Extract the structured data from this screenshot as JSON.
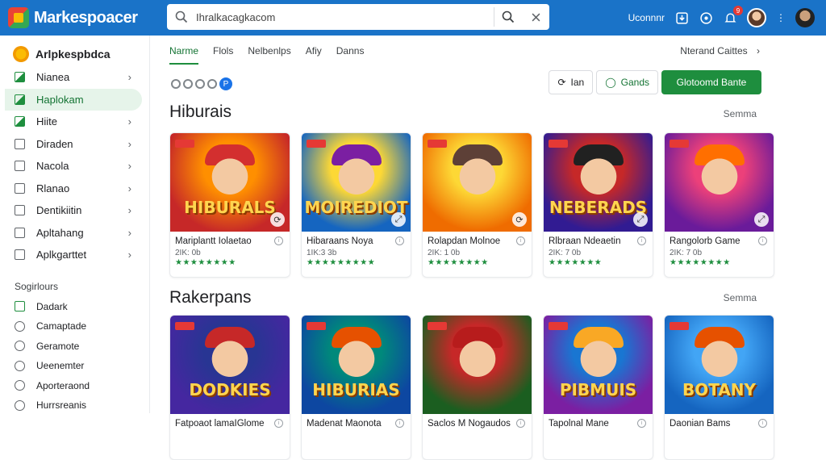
{
  "app": {
    "name": "Markespoacer",
    "search_value": "Ihralkacagkacom",
    "account_label": "Uconnnr",
    "notification_count": "9"
  },
  "sidebar": {
    "brand": "Arlpkespbdca",
    "items": [
      {
        "label": "Nianea",
        "chevron": "›"
      },
      {
        "label": "Haplokam",
        "chevron": ""
      },
      {
        "label": "Hiite",
        "chevron": "›"
      },
      {
        "label": "Diraden",
        "chevron": "›"
      },
      {
        "label": "Nacola",
        "chevron": "›"
      },
      {
        "label": "Rlanao",
        "chevron": "›"
      },
      {
        "label": "Dentikiitin",
        "chevron": "›"
      },
      {
        "label": "Apltahang",
        "chevron": "›"
      },
      {
        "label": "Aplkgarttet",
        "chevron": "›"
      }
    ],
    "section_title": "Sogirlours",
    "sub_items": [
      {
        "label": "Dadark"
      },
      {
        "label": "Camaptade"
      },
      {
        "label": "Geramote"
      },
      {
        "label": "Ueenemter"
      },
      {
        "label": "Aporteraond"
      },
      {
        "label": "Hurrsreanis"
      }
    ]
  },
  "main": {
    "tabs": [
      {
        "label": "Narme"
      },
      {
        "label": "Flols"
      },
      {
        "label": "Nelbenlps"
      },
      {
        "label": "Afiy"
      },
      {
        "label": "Danns"
      }
    ],
    "tabs_right": "Nterand Caittes",
    "dots_badge": "P",
    "actions": {
      "outline1": "Ian",
      "outline2": "Gands",
      "primary": "Glotoomd Bante"
    },
    "sections": [
      {
        "title": "Hiburais",
        "more": "Semma",
        "cards": [
          {
            "name": "Mariplantt Iolaetao",
            "sub": "2IK: 0b",
            "stars": "★★★★★★★★",
            "art": "HIBURALS",
            "c1": "#c62828",
            "c2": "#ff8f00",
            "hat": "#d32f2f",
            "mini": "⟳"
          },
          {
            "name": "Hibaraans Noya",
            "sub": "1IK:3 3b",
            "stars": "★★★★★★★★★",
            "art": "MOIREDIOT",
            "c1": "#1565c0",
            "c2": "#fdd835",
            "hat": "#7b1fa2",
            "mini": "⤢"
          },
          {
            "name": "Rolapdan Molnoe",
            "sub": "2IK: 1 0b",
            "stars": "★★★★★★★★",
            "art": "",
            "c1": "#ef6c00",
            "c2": "#fdd835",
            "hat": "#5d4037",
            "mini": "⟳"
          },
          {
            "name": "Rlbraan Ndeaetin",
            "sub": "2IK: 7 0b",
            "stars": "★★★★★★★",
            "art": "NEBERADS",
            "c1": "#311b92",
            "c2": "#c62828",
            "hat": "#212121",
            "mini": "⤢"
          },
          {
            "name": "Rangolorb Game",
            "sub": "2IK: 7 0b",
            "stars": "★★★★★★★★",
            "art": "",
            "c1": "#6a1b9a",
            "c2": "#ec407a",
            "hat": "#ff6f00",
            "mini": "⤢"
          }
        ]
      },
      {
        "title": "Rakerpans",
        "more": "Semma",
        "cards": [
          {
            "name": "Fatpoaot lamaIGlome",
            "sub": "",
            "stars": "",
            "art": "DODKIES",
            "c1": "#4527a0",
            "c2": "#283593",
            "hat": "#c62828",
            "mini": ""
          },
          {
            "name": "Madenat Maonota",
            "sub": "",
            "stars": "",
            "art": "HIBURIAS",
            "c1": "#0d47a1",
            "c2": "#00897b",
            "hat": "#e65100",
            "mini": ""
          },
          {
            "name": "Saclos M Nogaudos",
            "sub": "",
            "stars": "",
            "art": "",
            "c1": "#1b5e20",
            "c2": "#c62828",
            "hat": "#b71c1c",
            "mini": ""
          },
          {
            "name": "Tapolnal Mane",
            "sub": "",
            "stars": "",
            "art": "PIBMUIS",
            "c1": "#7b1fa2",
            "c2": "#1976d2",
            "hat": "#f9a825",
            "mini": ""
          },
          {
            "name": "Daonian Bams",
            "sub": "",
            "stars": "",
            "art": "BOTANY",
            "c1": "#1565c0",
            "c2": "#42a5f5",
            "hat": "#e65100",
            "mini": ""
          }
        ]
      }
    ]
  }
}
